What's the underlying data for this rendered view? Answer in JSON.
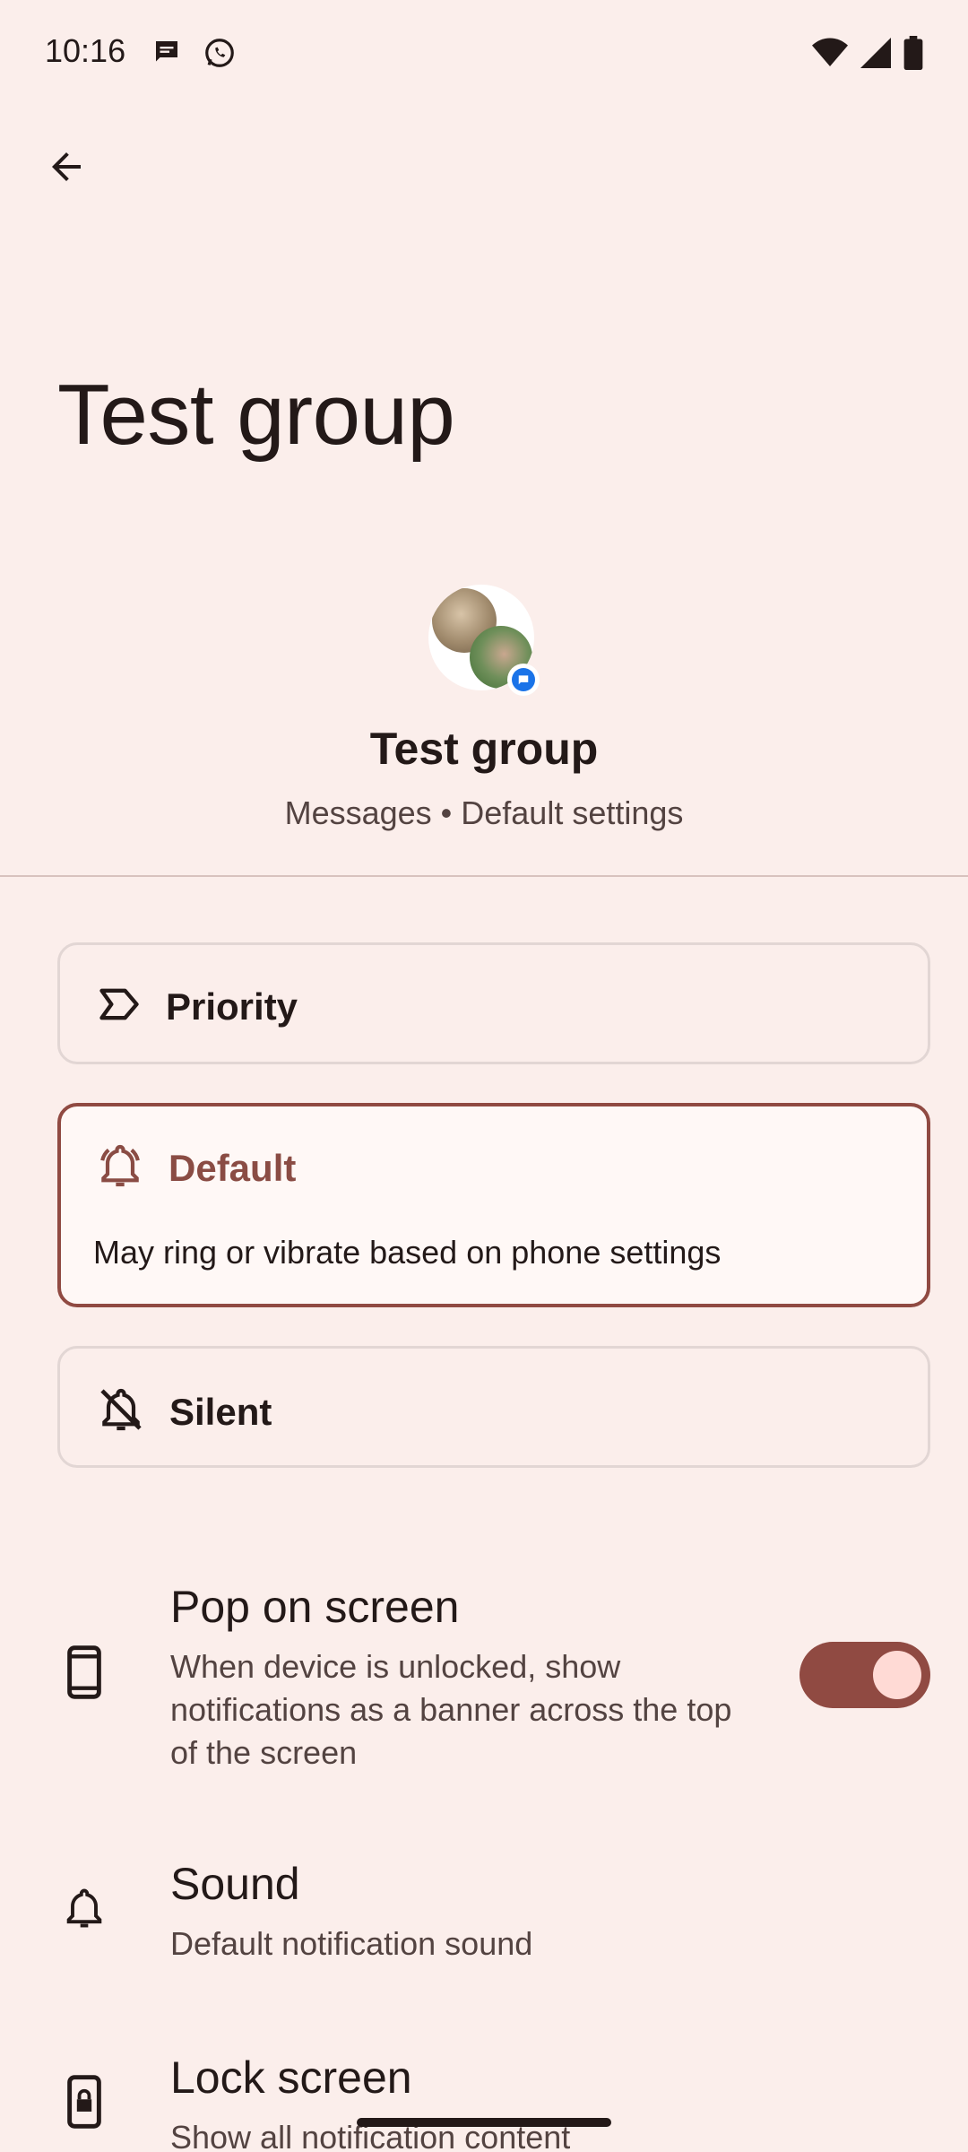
{
  "status_bar": {
    "time": "10:16",
    "notification_icons": [
      "messages-icon",
      "whatsapp-icon"
    ],
    "system_icons": [
      "wifi-icon",
      "signal-icon",
      "battery-icon"
    ]
  },
  "nav": {
    "back_icon": "arrow-back-icon"
  },
  "page": {
    "title": "Test group"
  },
  "conversation": {
    "name": "Test group",
    "subtitle": "Messages • Default settings"
  },
  "options": [
    {
      "label": "Priority",
      "icon": "priority-icon",
      "selected": false
    },
    {
      "label": "Default",
      "icon": "bell-ringing-icon",
      "selected": true,
      "description": "May ring or vibrate based on phone settings"
    },
    {
      "label": "Silent",
      "icon": "bell-off-icon",
      "selected": false
    }
  ],
  "settings": [
    {
      "title": "Pop on screen",
      "summary_lines": [
        "When device is unlocked, show",
        "notifications as a banner across the top",
        "of the screen"
      ],
      "icon": "phone-icon",
      "toggle_on": true
    },
    {
      "title": "Sound",
      "summary_lines": [
        "Default notification sound"
      ],
      "icon": "bell-icon"
    },
    {
      "title": "Lock screen",
      "summary_lines": [
        "Show all notification content"
      ],
      "icon": "lock-phone-icon"
    }
  ],
  "colors": {
    "background": "#fbeeeb",
    "accent": "#904a42",
    "toggle_thumb": "#ffdad5"
  }
}
